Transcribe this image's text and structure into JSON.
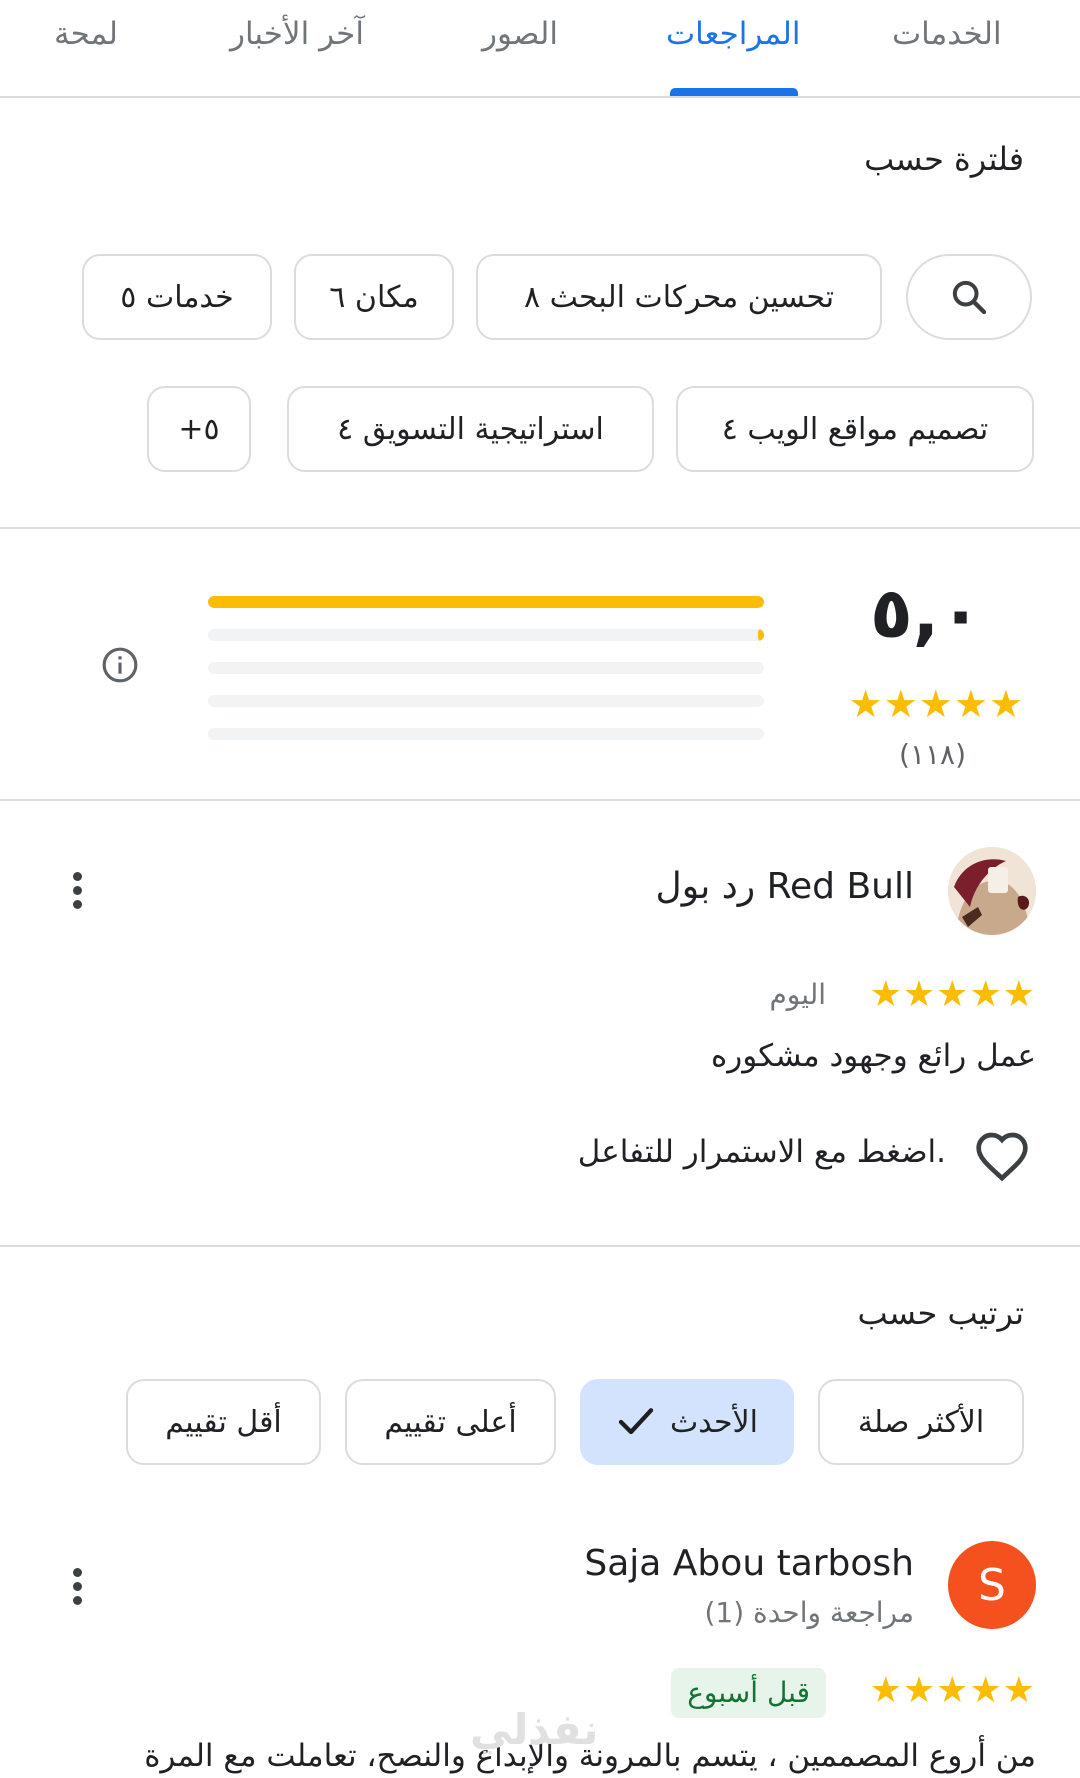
{
  "tabs": [
    {
      "label": "لمحة"
    },
    {
      "label": "آخر الأخبار"
    },
    {
      "label": "الصور"
    },
    {
      "label": "المراجعات"
    },
    {
      "label": "الخدمات"
    }
  ],
  "active_tab": "المراجعات",
  "filter": {
    "heading": "فلترة حسب",
    "chips": [
      {
        "label": "خدمات ٥"
      },
      {
        "label": "مكان ٦"
      },
      {
        "label": "تحسين محركات البحث ٨"
      },
      {
        "label": "تصميم مواقع الويب ٤"
      },
      {
        "label": "استراتيجية التسويق ٤"
      },
      {
        "label": "+٥"
      }
    ]
  },
  "summary": {
    "rating": "٥,٠",
    "stars": "★★★★★",
    "count": "(١١٨)",
    "distribution": [
      1.0,
      0.01,
      0,
      0,
      0
    ]
  },
  "review1": {
    "name": "رد بول Red Bull",
    "stars": "★★★★★",
    "date": "اليوم",
    "text": "عمل رائع وجهود مشكوره",
    "like_prompt": "اضغط مع الاستمرار للتفاعل."
  },
  "sort": {
    "heading": "ترتيب حسب",
    "options": [
      {
        "label": "الأكثر صلة"
      },
      {
        "label": "الأحدث"
      },
      {
        "label": "أعلى تقييم"
      },
      {
        "label": "أقل تقييم"
      }
    ],
    "selected": "الأحدث"
  },
  "review2": {
    "avatar_letter": "S",
    "name": "Saja Abou tarbosh",
    "review_count": "مراجعة واحدة (1)",
    "stars": "★★★★★",
    "date_badge": "قبل أسبوع",
    "text": "من أروع المصممين ، يتسم بالمرونة والإبداع والنصح، تعاملت مع المرة"
  },
  "watermark": "نفذلي",
  "colors": {
    "accent": "#1a73e8",
    "star": "#fbbc04",
    "selected_chip": "#d3e3fd",
    "avatar_s": "#f4511e",
    "badge_bg": "#e6f4ea"
  }
}
